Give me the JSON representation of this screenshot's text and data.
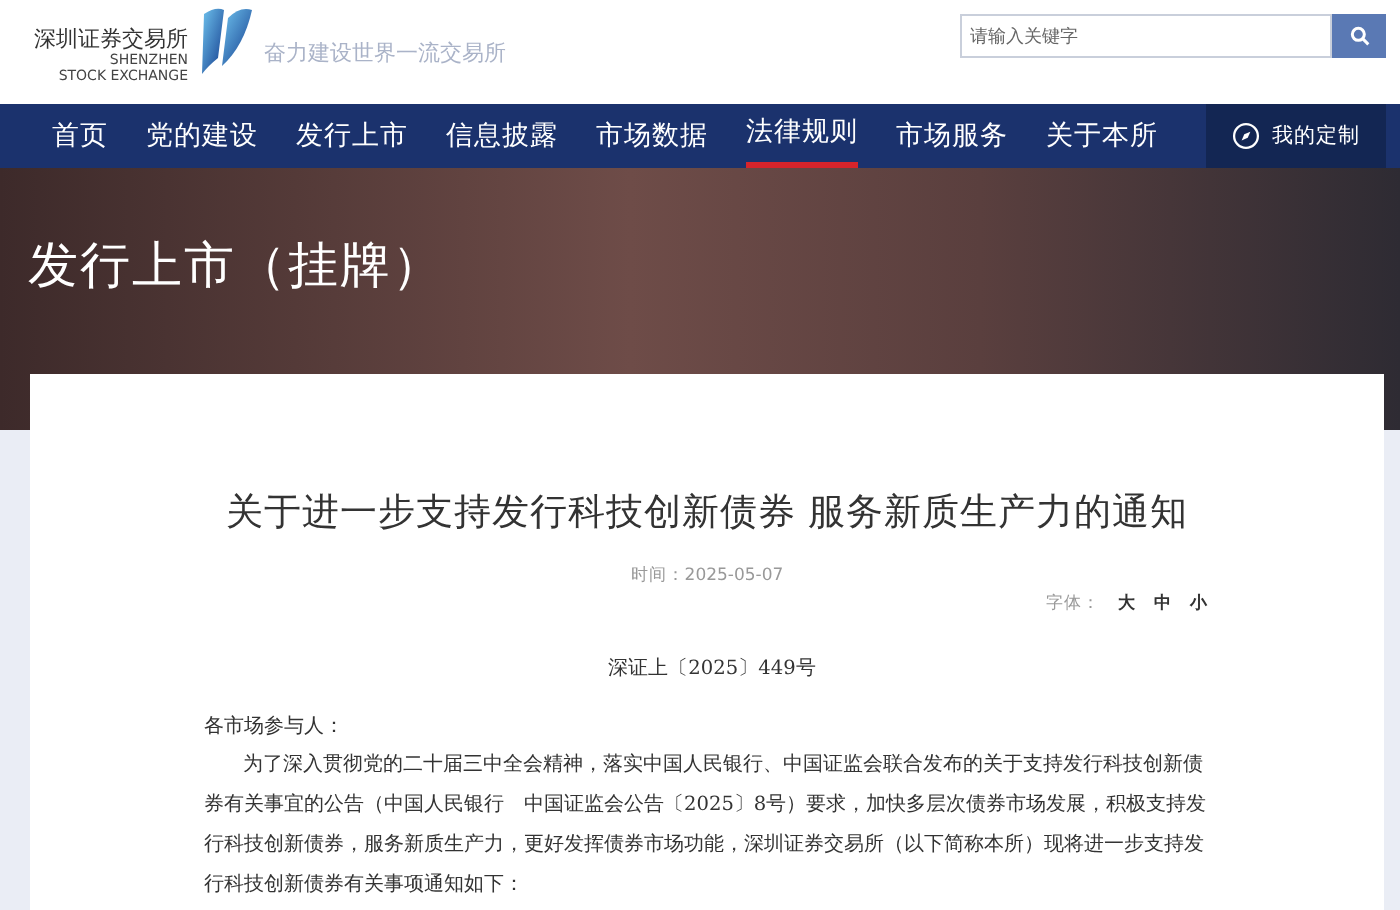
{
  "header": {
    "logo_cn": "深圳证券交易所",
    "logo_en_1": "SHENZHEN",
    "logo_en_2": "STOCK EXCHANGE",
    "tagline": "奋力建设世界一流交易所",
    "search": {
      "placeholder": "请输入关键字"
    }
  },
  "nav": [
    {
      "label": "首页",
      "selected": false
    },
    {
      "label": "党的建设",
      "selected": false
    },
    {
      "label": "发行上市",
      "selected": false
    },
    {
      "label": "信息披露",
      "selected": false
    },
    {
      "label": "市场数据",
      "selected": false
    },
    {
      "label": "法律规则",
      "selected": true
    },
    {
      "label": "市场服务",
      "selected": false
    },
    {
      "label": "关于本所",
      "selected": false
    }
  ],
  "custom_button": "我的定制",
  "banner": {
    "title": "发行上市（挂牌）"
  },
  "article": {
    "title": "关于进一步支持发行科技创新债券 服务新质生产力的通知",
    "time_label": "时间：",
    "time": "2025-05-07",
    "font_label": "字体：",
    "font_sizes": [
      "大",
      "中",
      "小"
    ],
    "doc_number": "深证上〔2025〕449号",
    "salutation": "各市场参与人：",
    "paragraphs": [
      "为了深入贯彻党的二十届三中全会精神，落实中国人民银行、中国证监会联合发布的关于支持发行科技创新债券有关事宜的公告（中国人民银行　中国证监会公告〔2025〕8号）要求，加快多层次债券市场发展，积极支持发行科技创新债券，服务新质生产力，更好发挥债券市场功能，深圳证券交易所（以下简称本所）现将进一步支持发行科技创新债券有关事项通知如下："
    ]
  }
}
